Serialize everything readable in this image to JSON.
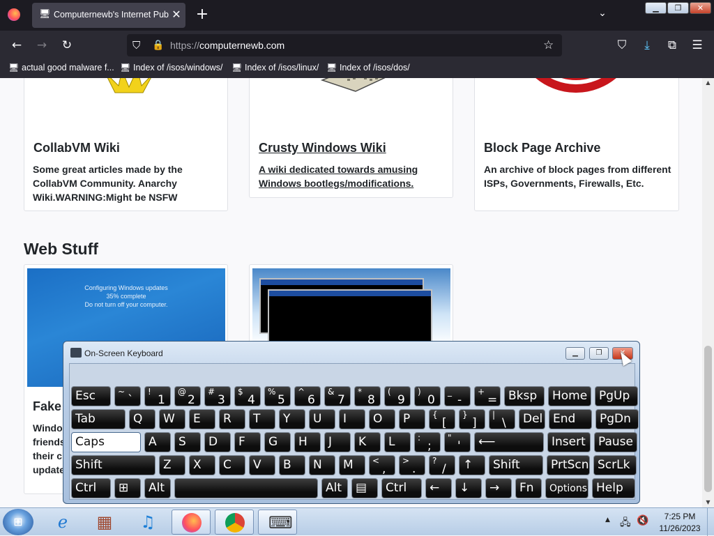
{
  "browser": {
    "tab_title": "Computernewb's Internet Pub",
    "tab_close": "✕",
    "new_tab": "+",
    "tab_list": "⌄",
    "url_protocol": "https://",
    "url_domain": "computernewb.com",
    "back_icon": "←",
    "forward_icon": "→",
    "reload_icon": "↻",
    "menu_icon": "☰",
    "bookmarks": [
      {
        "label": "actual good malware f..."
      },
      {
        "label": "Index of /isos/windows/"
      },
      {
        "label": "Index of /isos/linux/"
      },
      {
        "label": "Index of /isos/dos/"
      }
    ]
  },
  "window_buttons": {
    "minimize": "▁",
    "maximize": "❐",
    "close": "✕"
  },
  "page": {
    "cards_top": [
      {
        "title": "CollabVM Wiki",
        "desc": "Some great articles made by the CollabVM Community. Anarchy Wiki.WARNING:Might be NSFW"
      },
      {
        "title": "Crusty Windows Wiki",
        "desc": "A wiki dedicated towards amusing Windows bootlegs/modifications."
      },
      {
        "title": "Block Page Archive",
        "desc": "An archive of block pages from different ISPs, Governments, Firewalls, Etc."
      }
    ],
    "section_heading": "Web Stuff",
    "web_cards": [
      {
        "title": "Fake",
        "desc_lines": [
          "Windo",
          "friends",
          "their c",
          "update"
        ]
      }
    ],
    "win7_update_text": [
      "Configuring Windows updates",
      "35% complete",
      "Do not turn off your computer."
    ]
  },
  "osk": {
    "title": "On-Screen Keyboard",
    "rows": [
      [
        {
          "label": "Esc"
        },
        {
          "top": "~",
          "bottom": "`"
        },
        {
          "top": "!",
          "bottom": "1"
        },
        {
          "top": "@",
          "bottom": "2"
        },
        {
          "top": "#",
          "bottom": "3"
        },
        {
          "top": "$",
          "bottom": "4"
        },
        {
          "top": "%",
          "bottom": "5"
        },
        {
          "top": "^",
          "bottom": "6"
        },
        {
          "top": "&",
          "bottom": "7"
        },
        {
          "top": "*",
          "bottom": "8"
        },
        {
          "top": "(",
          "bottom": "9"
        },
        {
          "top": ")",
          "bottom": "0"
        },
        {
          "top": "_",
          "bottom": "-"
        },
        {
          "top": "+",
          "bottom": "="
        },
        {
          "label": "Bksp"
        },
        {
          "label": "Home"
        },
        {
          "label": "PgUp"
        }
      ],
      [
        {
          "label": "Tab"
        },
        {
          "label": "Q"
        },
        {
          "label": "W"
        },
        {
          "label": "E"
        },
        {
          "label": "R"
        },
        {
          "label": "T"
        },
        {
          "label": "Y"
        },
        {
          "label": "U"
        },
        {
          "label": "I"
        },
        {
          "label": "O"
        },
        {
          "label": "P"
        },
        {
          "top": "{",
          "bottom": "["
        },
        {
          "top": "}",
          "bottom": "]"
        },
        {
          "top": "|",
          "bottom": "\\"
        },
        {
          "label": "Del"
        },
        {
          "label": "End"
        },
        {
          "label": "PgDn"
        }
      ],
      [
        {
          "label": "Caps"
        },
        {
          "label": "A"
        },
        {
          "label": "S"
        },
        {
          "label": "D"
        },
        {
          "label": "F"
        },
        {
          "label": "G"
        },
        {
          "label": "H"
        },
        {
          "label": "J"
        },
        {
          "label": "K"
        },
        {
          "label": "L"
        },
        {
          "top": ":",
          "bottom": ";"
        },
        {
          "top": "\"",
          "bottom": "'"
        },
        {
          "label": "⟵"
        },
        {
          "label": "Insert"
        },
        {
          "label": "Pause"
        }
      ],
      [
        {
          "label": "Shift"
        },
        {
          "label": "Z"
        },
        {
          "label": "X"
        },
        {
          "label": "C"
        },
        {
          "label": "V"
        },
        {
          "label": "B"
        },
        {
          "label": "N"
        },
        {
          "label": "M"
        },
        {
          "top": "<",
          "bottom": ","
        },
        {
          "top": ">",
          "bottom": "."
        },
        {
          "top": "?",
          "bottom": "/"
        },
        {
          "label": "↑"
        },
        {
          "label": "Shift"
        },
        {
          "label": "PrtScn"
        },
        {
          "label": "ScrLk"
        }
      ],
      [
        {
          "label": "Ctrl"
        },
        {
          "label": "⊞"
        },
        {
          "label": "Alt"
        },
        {
          "label": ""
        },
        {
          "label": "Alt"
        },
        {
          "label": "▤"
        },
        {
          "label": "Ctrl"
        },
        {
          "label": "←"
        },
        {
          "label": "↓"
        },
        {
          "label": "→"
        },
        {
          "label": "Fn"
        },
        {
          "label": "Options"
        },
        {
          "label": "Help"
        }
      ]
    ]
  },
  "taskbar": {
    "clock_time": "7:25 PM",
    "clock_date": "11/26/2023",
    "tray_arrow": "▲"
  }
}
